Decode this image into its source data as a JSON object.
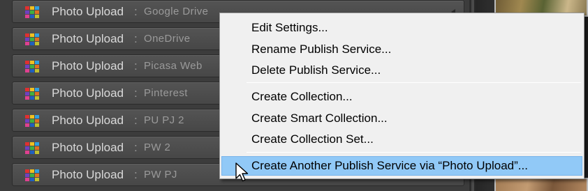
{
  "publish_services": [
    {
      "name": "Photo Upload",
      "separator": ":",
      "account": "Google Drive"
    },
    {
      "name": "Photo Upload",
      "separator": ":",
      "account": "OneDrive"
    },
    {
      "name": "Photo Upload",
      "separator": ":",
      "account": "Picasa Web"
    },
    {
      "name": "Photo Upload",
      "separator": ":",
      "account": "Pinterest"
    },
    {
      "name": "Photo Upload",
      "separator": ":",
      "account": "PU PJ 2"
    },
    {
      "name": "Photo Upload",
      "separator": ":",
      "account": "PW 2"
    },
    {
      "name": "Photo Upload",
      "separator": ":",
      "account": "PW PJ"
    }
  ],
  "context_menu": {
    "items": [
      "Edit Settings...",
      "Rename Publish Service...",
      "Delete Publish Service...",
      "Create Collection...",
      "Create Smart Collection...",
      "Create Collection Set...",
      "Create Another Publish Service via “Photo Upload”..."
    ],
    "highlighted_item": "Create Another Publish Service via “Photo Upload”..."
  },
  "colors": {
    "panel_bg": "#3c3c3c",
    "row_bg": "#4f4f4f",
    "menu_bg": "#f0f0f0",
    "menu_highlight": "#91c9f7"
  },
  "icons": {
    "service_icon": "photo-upload-plugin-icon",
    "cursor": "arrow-cursor-icon"
  }
}
